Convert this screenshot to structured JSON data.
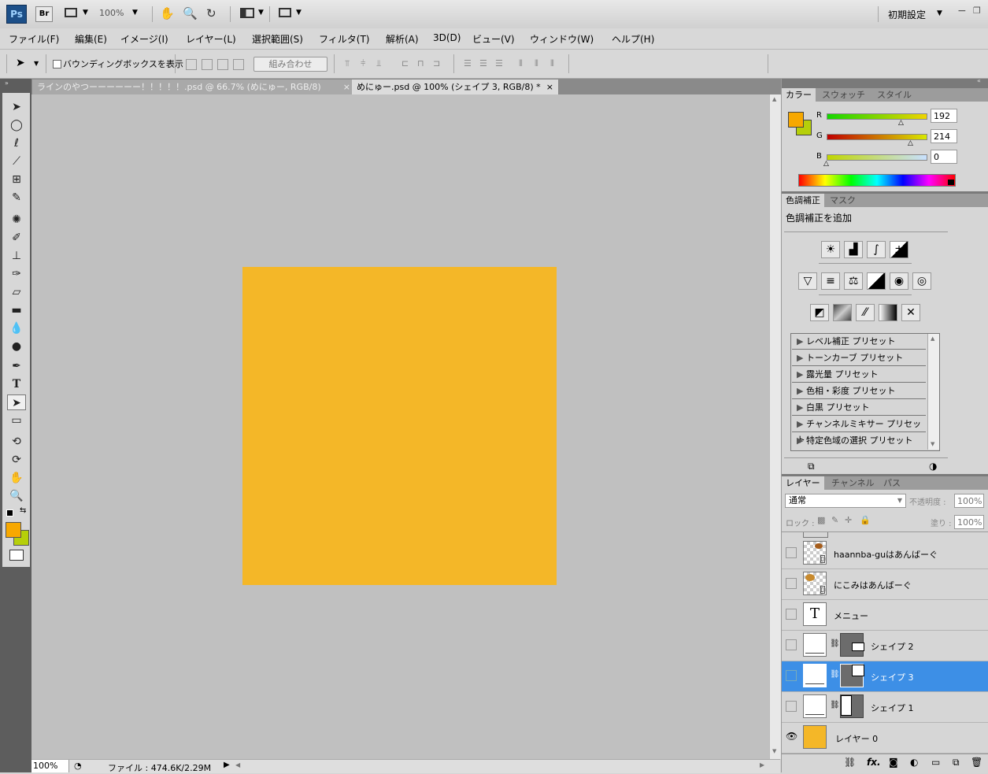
{
  "app": {
    "logo": "Ps",
    "bridge_label": "Br",
    "zoom": "100%",
    "workspace": "初期設定",
    "accent_color": "#f4b728",
    "icons": [
      "layout-icon",
      "hand-icon",
      "zoom-icon",
      "rotate-view-icon",
      "arrange-icon",
      "screen-mode-icon"
    ]
  },
  "menu": [
    "ファイル(F)",
    "編集(E)",
    "イメージ(I)",
    "レイヤー(L)",
    "選択範囲(S)",
    "フィルタ(T)",
    "解析(A)",
    "3D(D)",
    "ビュー(V)",
    "ウィンドウ(W)",
    "ヘルプ(H)"
  ],
  "options": {
    "show_bbox_label": "バウンディングボックスを表示",
    "combine_button": "組み合わせ"
  },
  "tabs": [
    {
      "label": "ラインのやつーーーーーー！！！！！.psd @ 66.7% (めにゅー, RGB/8)",
      "close": "×",
      "active": false
    },
    {
      "label": "めにゅー.psd @ 100% (シェイプ 3, RGB/8) *",
      "close": "×",
      "active": true
    }
  ],
  "canvas": {
    "fill_color": "#f4b728",
    "background": "#c0c0c0"
  },
  "status": {
    "zoom": "100%",
    "file_info": "ファイル : 474.6K/2.29M"
  },
  "tools": {
    "foreground_color": "#f7a800",
    "background_color": "#b6cf0a",
    "icons": [
      "move-icon",
      "marquee-icon",
      "lasso-icon",
      "magic-wand-icon",
      "crop-icon",
      "eyedropper-icon",
      "spot-healing-icon",
      "brush-icon",
      "stamp-icon",
      "history-brush-icon",
      "eraser-icon",
      "gradient-icon",
      "blur-icon",
      "dodge-icon",
      "pen-icon",
      "type-icon",
      "path-select-icon",
      "shape-icon",
      "3d-rotate-icon",
      "3d-orbit-icon",
      "hand-icon",
      "zoom-icon"
    ]
  },
  "color_panel": {
    "tabs": [
      "カラー",
      "スウォッチ",
      "スタイル"
    ],
    "channels": [
      {
        "label": "R",
        "value": "192"
      },
      {
        "label": "G",
        "value": "214"
      },
      {
        "label": "B",
        "value": "0"
      }
    ],
    "foreground": "#f7a800",
    "background": "#b6cf0a"
  },
  "adjust_panel": {
    "tabs": [
      "色調補正",
      "マスク"
    ],
    "heading": "色調補正を追加",
    "presets": [
      "レベル補正 プリセット",
      "トーンカーブ プリセット",
      "露光量 プリセット",
      "色相・彩度 プリセット",
      "白黒 プリセット",
      "チャンネルミキサー プリセット",
      "特定色域の選択 プリセット"
    ]
  },
  "layers_panel": {
    "tabs": [
      "レイヤー",
      "チャンネル",
      "パス"
    ],
    "blend_mode": "通常",
    "opacity_label": "不透明度 :",
    "opacity_value": "100%",
    "lock_label": "ロック :",
    "fill_label": "塗り :",
    "fill_value": "100%",
    "layers": [
      {
        "name": "haannba-guはあんばーぐ",
        "type": "smart",
        "visible": false,
        "selected": false
      },
      {
        "name": "にこみはあんばーぐ",
        "type": "smart",
        "visible": false,
        "selected": false
      },
      {
        "name": "メニュー",
        "type": "text",
        "visible": false,
        "selected": false
      },
      {
        "name": "シェイプ 2",
        "type": "shape",
        "visible": false,
        "selected": false
      },
      {
        "name": "シェイプ 3",
        "type": "shape",
        "visible": false,
        "selected": true
      },
      {
        "name": "シェイプ 1",
        "type": "shape",
        "visible": false,
        "selected": false
      },
      {
        "name": "レイヤー 0",
        "type": "fill",
        "visible": true,
        "selected": false
      }
    ],
    "type_glyph": "T",
    "footer_icons": [
      "link-icon",
      "fx-icon",
      "mask-icon",
      "adjustment-icon",
      "group-icon",
      "new-layer-icon",
      "trash-icon"
    ]
  }
}
